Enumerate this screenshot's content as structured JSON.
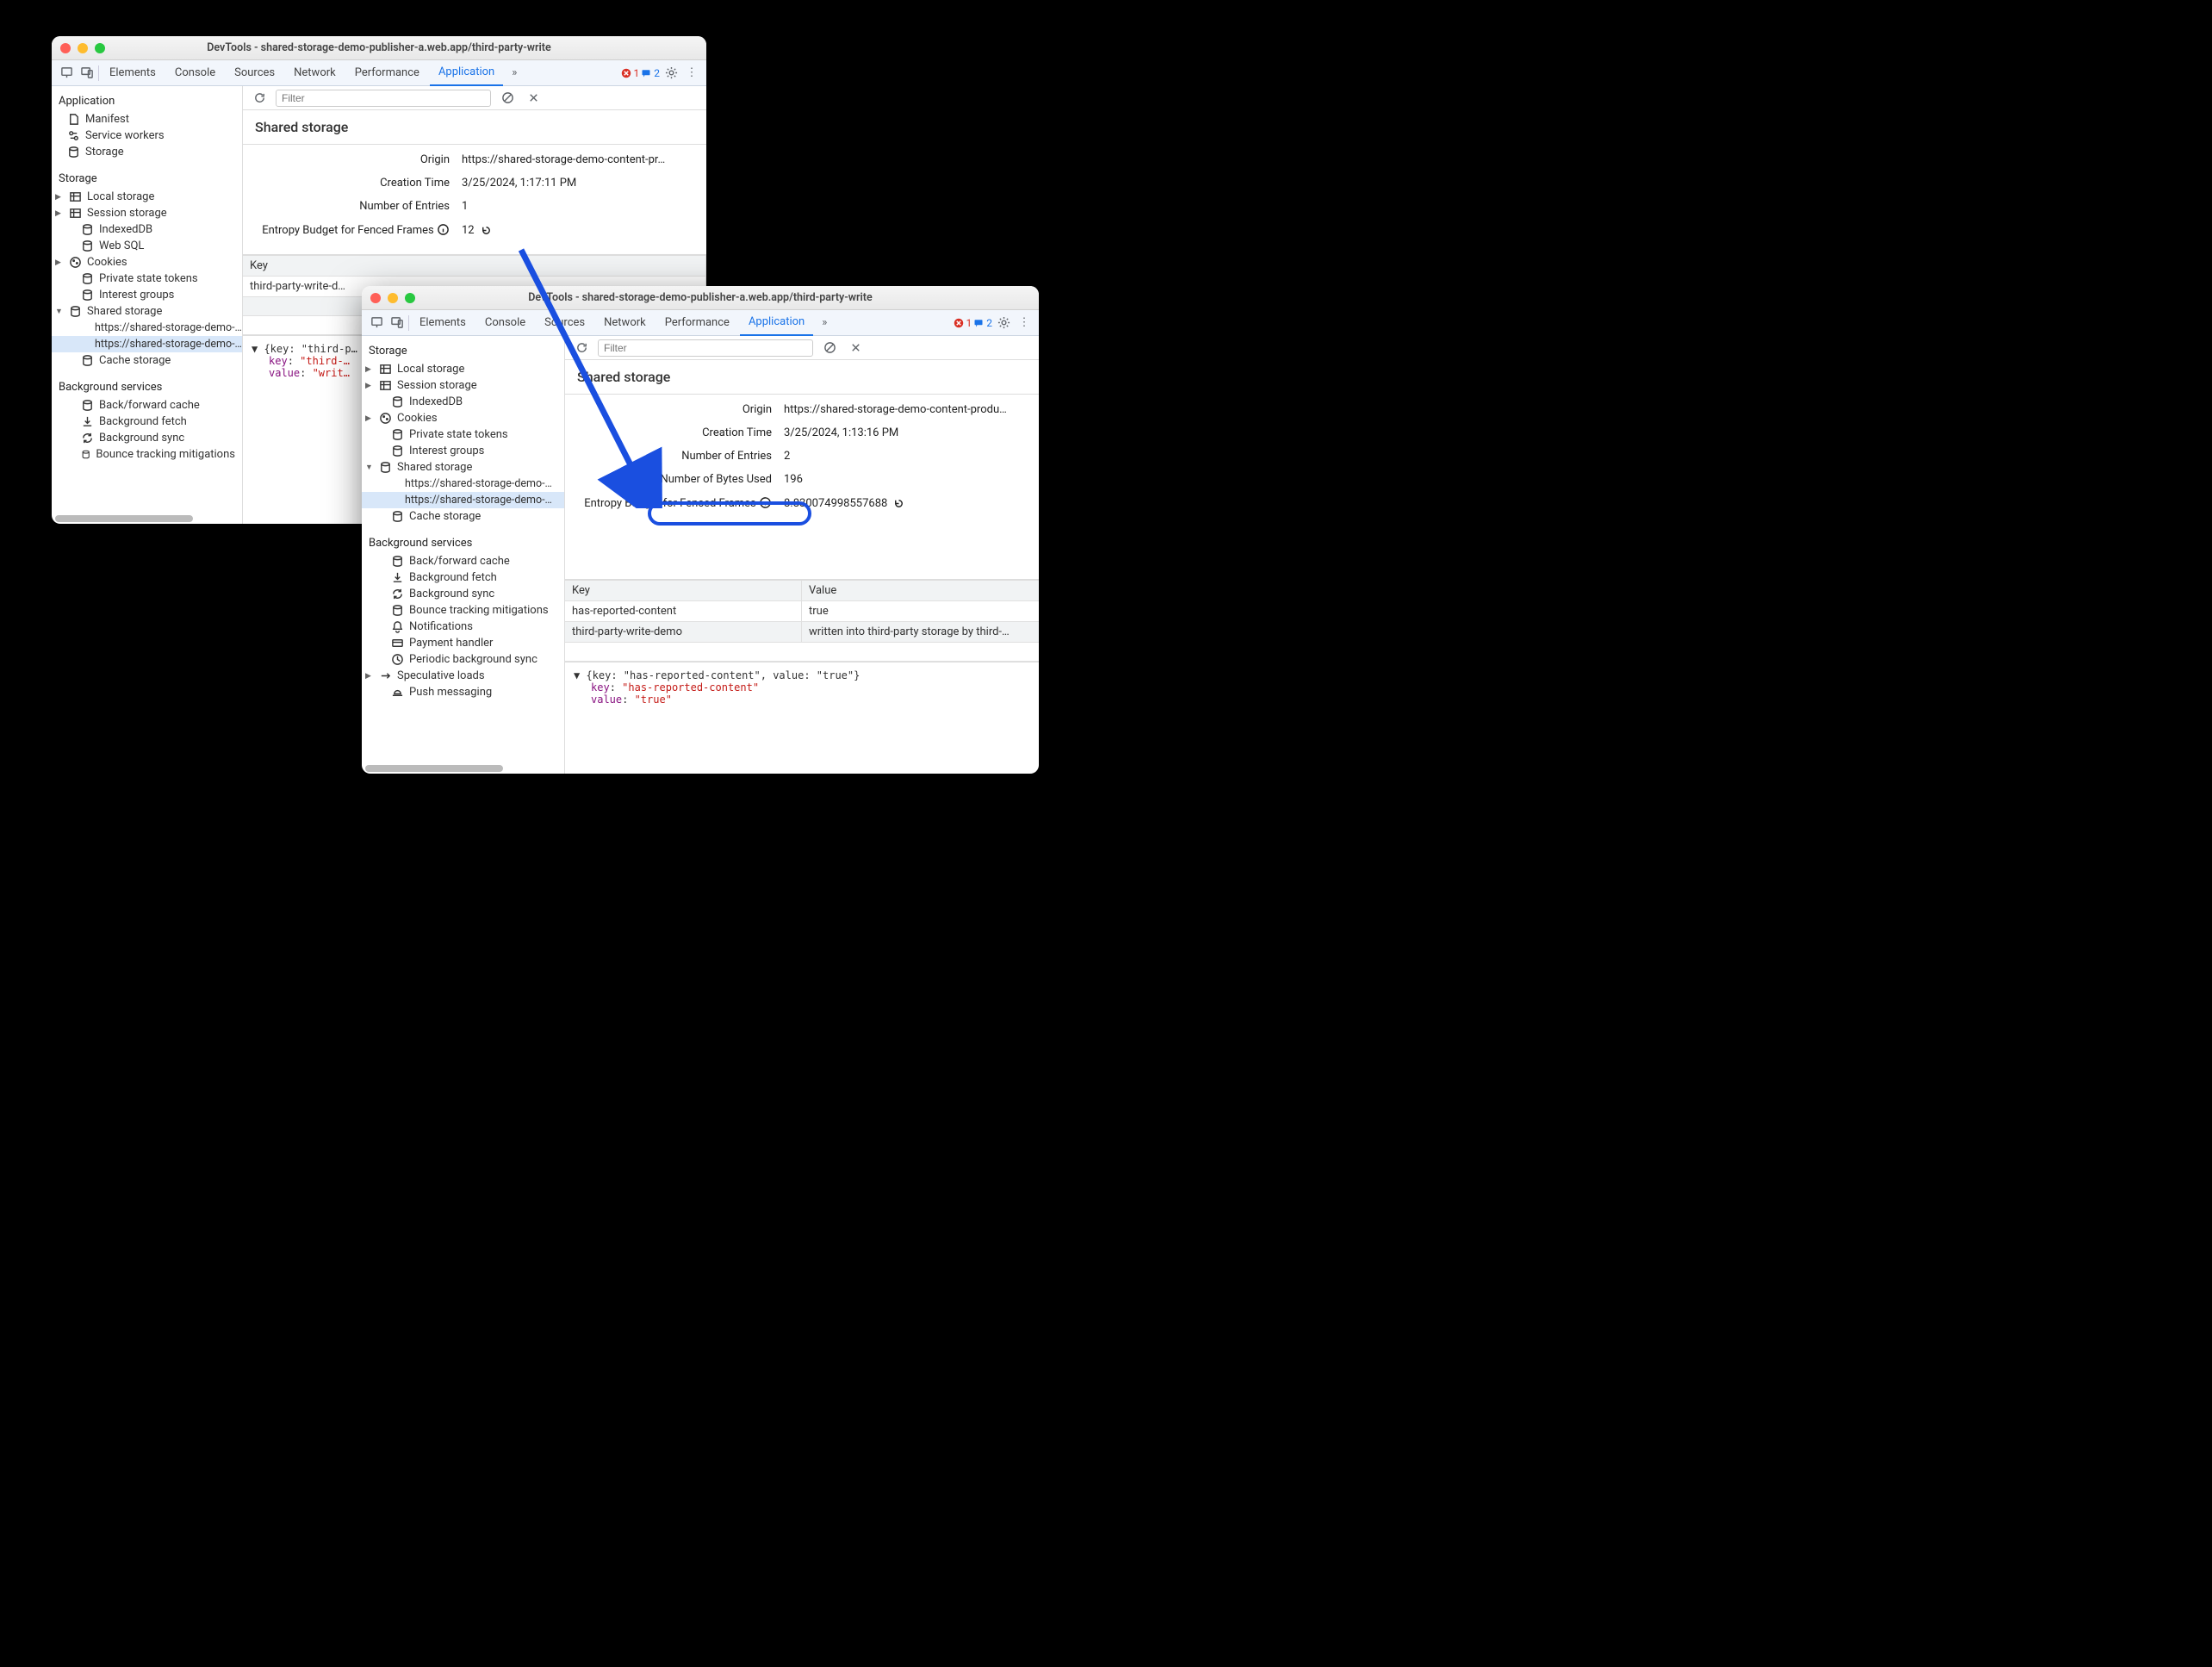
{
  "windows": [
    {
      "title": "DevTools - shared-storage-demo-publisher-a.web.app/third-party-write",
      "tabs": [
        "Elements",
        "Console",
        "Sources",
        "Network",
        "Performance",
        "Application"
      ],
      "active_tab": "Application",
      "errors": 1,
      "messages": 2,
      "sidebar": {
        "application": {
          "label": "Application",
          "items": [
            "Manifest",
            "Service workers",
            "Storage"
          ]
        },
        "storage": {
          "label": "Storage",
          "items": [
            {
              "label": "Local storage",
              "expandable": true
            },
            {
              "label": "Session storage",
              "expandable": true
            },
            {
              "label": "IndexedDB"
            },
            {
              "label": "Web SQL"
            },
            {
              "label": "Cookies",
              "expandable": true
            },
            {
              "label": "Private state tokens"
            },
            {
              "label": "Interest groups"
            },
            {
              "label": "Shared storage",
              "expanded": true,
              "children": [
                "https://shared-storage-demo-…",
                "https://shared-storage-demo-…"
              ]
            },
            {
              "label": "Cache storage"
            }
          ]
        },
        "bg": {
          "label": "Background services",
          "items": [
            "Back/forward cache",
            "Background fetch",
            "Background sync",
            "Bounce tracking mitigations"
          ]
        }
      },
      "filter_placeholder": "Filter",
      "panel": {
        "heading": "Shared storage",
        "rows": [
          {
            "label": "Origin",
            "value": "https://shared-storage-demo-content-pr…"
          },
          {
            "label": "Creation Time",
            "value": "3/25/2024, 1:17:11 PM"
          },
          {
            "label": "Number of Entries",
            "value": "1"
          },
          {
            "label": "Entropy Budget for Fenced Frames",
            "value": "12",
            "info": true,
            "reset": true
          }
        ],
        "table": {
          "headers": [
            "Key"
          ],
          "rows": [
            [
              "third-party-write-d…"
            ]
          ]
        },
        "json": {
          "summary": "{key: \"third-p…",
          "key": "\"third-…",
          "value": "\"writ…"
        }
      }
    },
    {
      "title": "DevTools - shared-storage-demo-publisher-a.web.app/third-party-write",
      "tabs": [
        "Elements",
        "Console",
        "Sources",
        "Network",
        "Performance",
        "Application"
      ],
      "active_tab": "Application",
      "errors": 1,
      "messages": 2,
      "sidebar": {
        "storage": {
          "label": "Storage",
          "items": [
            {
              "label": "Local storage",
              "expandable": true
            },
            {
              "label": "Session storage",
              "expandable": true
            },
            {
              "label": "IndexedDB"
            },
            {
              "label": "Cookies",
              "expandable": true
            },
            {
              "label": "Private state tokens"
            },
            {
              "label": "Interest groups"
            },
            {
              "label": "Shared storage",
              "expanded": true,
              "children": [
                "https://shared-storage-demo-…",
                "https://shared-storage-demo-…"
              ]
            },
            {
              "label": "Cache storage"
            }
          ]
        },
        "bg": {
          "label": "Background services",
          "items": [
            "Back/forward cache",
            "Background fetch",
            "Background sync",
            "Bounce tracking mitigations",
            "Notifications",
            "Payment handler",
            "Periodic background sync",
            "Speculative loads",
            "Push messaging"
          ]
        }
      },
      "filter_placeholder": "Filter",
      "panel": {
        "heading": "Shared storage",
        "rows": [
          {
            "label": "Origin",
            "value": "https://shared-storage-demo-content-produ…"
          },
          {
            "label": "Creation Time",
            "value": "3/25/2024, 1:13:16 PM"
          },
          {
            "label": "Number of Entries",
            "value": "2"
          },
          {
            "label": "Number of Bytes Used",
            "value": "196"
          },
          {
            "label": "Entropy Budget for Fenced Frames",
            "value": "8.830074998557688",
            "info": true,
            "reset": true
          }
        ],
        "table": {
          "headers": [
            "Key",
            "Value"
          ],
          "rows": [
            [
              "has-reported-content",
              "true"
            ],
            [
              "third-party-write-demo",
              "written into third-party storage by third-…"
            ]
          ]
        },
        "json": {
          "summary": "{key: \"has-reported-content\", value: \"true\"}",
          "key": "\"has-reported-content\"",
          "value": "\"true\""
        }
      }
    }
  ]
}
